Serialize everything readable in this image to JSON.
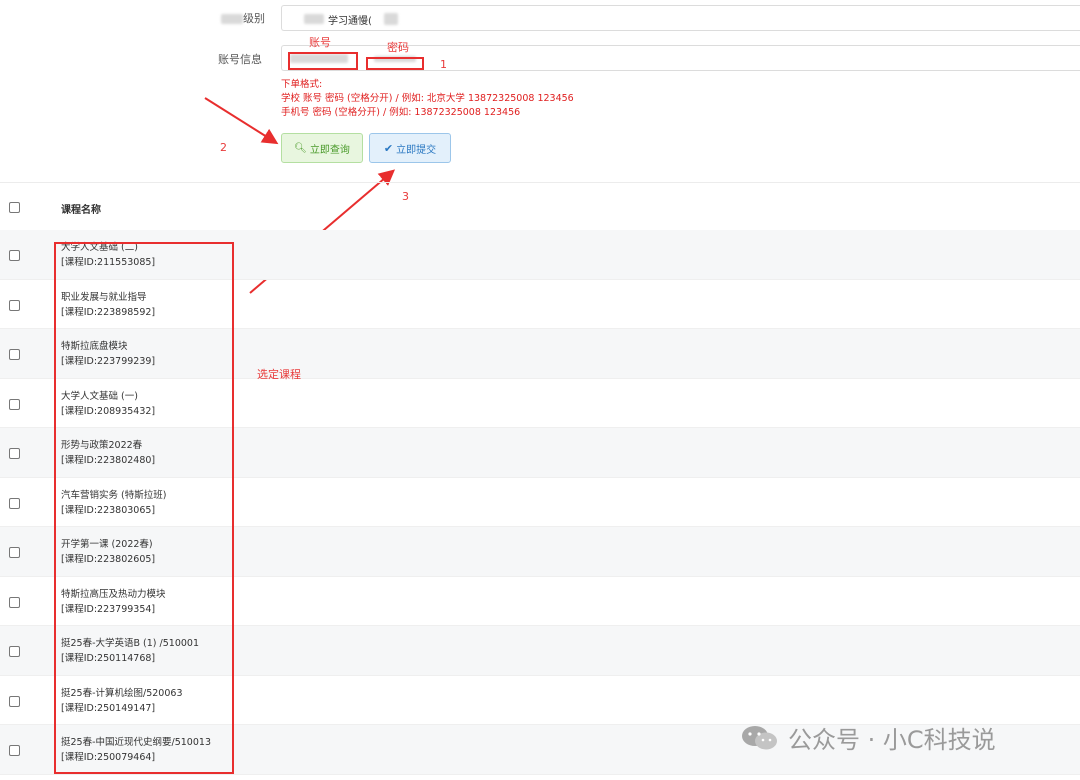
{
  "form": {
    "class_label_suffix": "级别",
    "class_value": "学习通慢(",
    "account_label": "账号信息",
    "annotation_account": "账号",
    "annotation_password": "密码",
    "step1": "1",
    "step2": "2",
    "step3": "3",
    "hint_title": "下单格式:",
    "hint_line1": "学校 账号 密码 (空格分开) / 例如:  北京大学 13872325008 123456",
    "hint_line2": "手机号 密码 (空格分开) / 例如:  13872325008 123456",
    "query_button": "立即查询",
    "submit_button": "立即提交",
    "query_icon": "search-plus-icon",
    "submit_icon": "check-icon"
  },
  "table": {
    "header_name": "课程名称",
    "select_annotation": "选定课程",
    "rows": [
      {
        "name": "大学人文基础 (二)",
        "id": "[课程ID:211553085]"
      },
      {
        "name": "职业发展与就业指导",
        "id": "[课程ID:223898592]"
      },
      {
        "name": "特斯拉底盘模块",
        "id": "[课程ID:223799239]"
      },
      {
        "name": "大学人文基础 (一)",
        "id": "[课程ID:208935432]"
      },
      {
        "name": "形势与政策2022春",
        "id": "[课程ID:223802480]"
      },
      {
        "name": "汽车营销实务 (特斯拉班)",
        "id": "[课程ID:223803065]"
      },
      {
        "name": "开学第一课 (2022春)",
        "id": "[课程ID:223802605]"
      },
      {
        "name": "特斯拉高压及热动力模块",
        "id": "[课程ID:223799354]"
      },
      {
        "name": "挺25春-大学英语B (1) /510001",
        "id": "[课程ID:250114768]"
      },
      {
        "name": "挺25春-计算机绘图/520063",
        "id": "[课程ID:250149147]"
      },
      {
        "name": "挺25春-中国近现代史纲要/510013",
        "id": "[课程ID:250079464]"
      }
    ]
  },
  "watermark": {
    "text": "公众号 · 小C科技说",
    "icon": "wechat-icon"
  },
  "colors": {
    "annotation_red": "#e83a3a",
    "query_green": "#4a9a2a",
    "submit_blue": "#2a78c2"
  }
}
